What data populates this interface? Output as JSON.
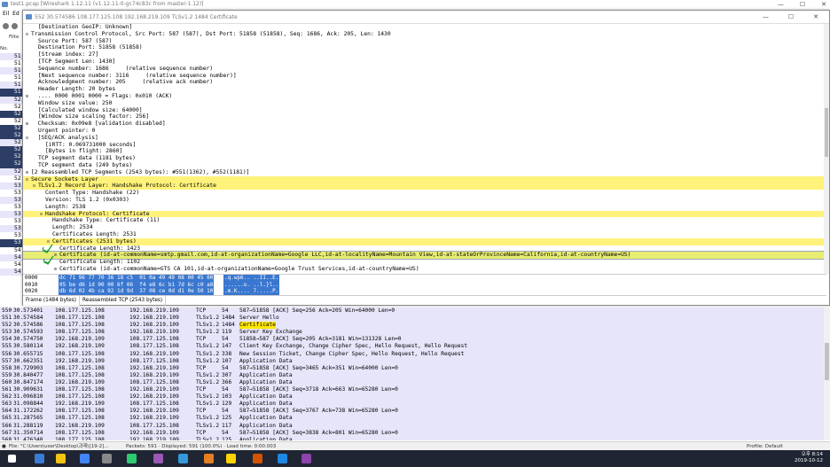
{
  "main_window": {
    "title": "test1.pcap  [Wireshark 1.12.11  (v1.12.11-0-gc74c83c from master-1.12)]",
    "menu": [
      "Eil",
      "Ed"
    ],
    "filter_label": "Filte",
    "no_header": "No.",
    "left_numbers": [
      "51",
      "51",
      "51",
      "51",
      "51",
      "51",
      "52",
      "52",
      "52",
      "52",
      "52",
      "52",
      "52",
      "52",
      "52",
      "52",
      "52",
      "52",
      "53",
      "53",
      "53",
      "53",
      "53",
      "53",
      "53",
      "53",
      "53",
      "54",
      "54",
      "54",
      "54"
    ]
  },
  "detail_window": {
    "title": "552 30.574586 108.177.125.108 192.168.219.109 TLSv1.2 1484 Certificate",
    "tree": [
      {
        "indent": 1,
        "toggle": "",
        "text": "[Destination GeoIP: Unknown]",
        "style": ""
      },
      {
        "indent": 0,
        "toggle": "⊟",
        "text": "Transmission Control Protocol, Src Port: 587 (587), Dst Port: 51858 (51858), Seq: 1686, Ack: 205, Len: 1430",
        "style": ""
      },
      {
        "indent": 1,
        "toggle": "",
        "text": "Source Port: 587 (587)",
        "style": ""
      },
      {
        "indent": 1,
        "toggle": "",
        "text": "Destination Port: 51858 (51858)",
        "style": ""
      },
      {
        "indent": 1,
        "toggle": "",
        "text": "[Stream index: 27]",
        "style": ""
      },
      {
        "indent": 1,
        "toggle": "",
        "text": "[TCP Segment Len: 1430]",
        "style": ""
      },
      {
        "indent": 1,
        "toggle": "",
        "text": "Sequence number: 1686     (relative sequence number)",
        "style": ""
      },
      {
        "indent": 1,
        "toggle": "",
        "text": "[Next sequence number: 3116     (relative sequence number)]",
        "style": ""
      },
      {
        "indent": 1,
        "toggle": "",
        "text": "Acknowledgment number: 205     (relative ack number)",
        "style": ""
      },
      {
        "indent": 1,
        "toggle": "",
        "text": "Header Length: 20 bytes",
        "style": ""
      },
      {
        "indent": 0,
        "toggle": "⊞",
        "text": "  .... 0000 0001 0000 = Flags: 0x010 (ACK)",
        "style": ""
      },
      {
        "indent": 1,
        "toggle": "",
        "text": "Window size value: 250",
        "style": ""
      },
      {
        "indent": 1,
        "toggle": "",
        "text": "[Calculated window size: 64000]",
        "style": ""
      },
      {
        "indent": 1,
        "toggle": "",
        "text": "[Window size scaling factor: 256]",
        "style": ""
      },
      {
        "indent": 0,
        "toggle": "⊞",
        "text": "  Checksum: 0x09e8 [validation disabled]",
        "style": ""
      },
      {
        "indent": 1,
        "toggle": "",
        "text": "Urgent pointer: 0",
        "style": ""
      },
      {
        "indent": 0,
        "toggle": "⊟",
        "text": "  [SEQ/ACK analysis]",
        "style": ""
      },
      {
        "indent": 2,
        "toggle": "",
        "text": "[iRTT: 0.069731000 seconds]",
        "style": ""
      },
      {
        "indent": 2,
        "toggle": "",
        "text": "[Bytes in flight: 2860]",
        "style": ""
      },
      {
        "indent": 1,
        "toggle": "",
        "text": "TCP segment data (1181 bytes)",
        "style": ""
      },
      {
        "indent": 1,
        "toggle": "",
        "text": "TCP segment data (249 bytes)",
        "style": ""
      },
      {
        "indent": 0,
        "toggle": "⊞",
        "text": "[2 Reassembled TCP Segments (2543 bytes): #551(1362), #552(1181)]",
        "style": ""
      },
      {
        "indent": 0,
        "toggle": "⊟",
        "text": "Secure Sockets Layer",
        "style": "hl"
      },
      {
        "indent": 1,
        "toggle": "⊟",
        "text": "TLSv1.2 Record Layer: Handshake Protocol: Certificate",
        "style": "hl"
      },
      {
        "indent": 2,
        "toggle": "",
        "text": "Content Type: Handshake (22)",
        "style": ""
      },
      {
        "indent": 2,
        "toggle": "",
        "text": "Version: TLS 1.2 (0x0303)",
        "style": ""
      },
      {
        "indent": 2,
        "toggle": "",
        "text": "Length: 2538",
        "style": ""
      },
      {
        "indent": 2,
        "toggle": "⊟",
        "text": "Handshake Protocol: Certificate",
        "style": "hl"
      },
      {
        "indent": 3,
        "toggle": "",
        "text": "Handshake Type: Certificate (11)",
        "style": ""
      },
      {
        "indent": 3,
        "toggle": "",
        "text": "Length: 2534",
        "style": ""
      },
      {
        "indent": 3,
        "toggle": "",
        "text": "Certificates Length: 2531",
        "style": ""
      },
      {
        "indent": 3,
        "toggle": "⊟",
        "text": "Certificates (2531 bytes)",
        "style": "hl"
      },
      {
        "indent": 4,
        "toggle": "",
        "text": "Certificate Length: 1423",
        "style": ""
      },
      {
        "indent": 4,
        "toggle": "⊞",
        "text": "Certificate (id-at-commonName=smtp.gmail.com,id-at-organizationName=Google LLC,id-at-localityName=Mountain View,id-at-stateOrProvinceName=California,id-at-countryName=US)",
        "style": "focus"
      },
      {
        "indent": 4,
        "toggle": "",
        "text": "Certificate Length: 1102",
        "style": ""
      },
      {
        "indent": 4,
        "toggle": "⊞",
        "text": "Certificate (id-at-commonName=GTS CA 101,id-at-organizationName=Google Trust Services,id-at-countryName=US)",
        "style": ""
      }
    ],
    "bytes": [
      {
        "offset": "0000",
        "hex": "dc 71 96 77 70 36 18 c5  01 0a 49 49 08 00 45 00",
        "ascii": ".q.wp6.. ..II..E."
      },
      {
        "offset": "0010",
        "hex": "05 be d6 1d 00 00 6f 06  f4 e8 6c b1 7d 6c c0 a8",
        "ascii": "......o. ..l.}l.."
      },
      {
        "offset": "0020",
        "hex": "db 6d 02 4b ca 92 1d 9d  37 08 ce 0d d1 0e 50 10",
        "ascii": ".m.K.... 7.....P."
      }
    ],
    "tabs": [
      "Frame (1484 bytes)",
      "Reassembled TCP (2543 bytes)"
    ]
  },
  "packets": [
    {
      "no": "550",
      "time": "30.573401",
      "src": "108.177.125.108",
      "dst": "192.168.219.109",
      "proto": "TCP",
      "len": "54",
      "info": "587→51858 [ACK] Seq=256 Ack=205 Win=64000 Len=0",
      "hl": ""
    },
    {
      "no": "551",
      "time": "30.574584",
      "src": "108.177.125.108",
      "dst": "192.168.219.109",
      "proto": "TLSv1.2",
      "len": "1484",
      "info": "Server Hello",
      "hl": ""
    },
    {
      "no": "552",
      "time": "30.574586",
      "src": "108.177.125.108",
      "dst": "192.168.219.109",
      "proto": "TLSv1.2",
      "len": "1484",
      "info": "",
      "hl": "Certificate"
    },
    {
      "no": "553",
      "time": "30.574593",
      "src": "108.177.125.108",
      "dst": "192.168.219.109",
      "proto": "TLSv1.2",
      "len": "119",
      "info": "Server Key Exchange",
      "hl": ""
    },
    {
      "no": "554",
      "time": "30.574750",
      "src": "192.168.219.109",
      "dst": "108.177.125.108",
      "proto": "TCP",
      "len": "54",
      "info": "51858→587 [ACK] Seq=205 Ack=3181 Win=131328 Len=0",
      "hl": ""
    },
    {
      "no": "555",
      "time": "30.580114",
      "src": "192.168.219.109",
      "dst": "108.177.125.108",
      "proto": "TLSv1.2",
      "len": "147",
      "info": "Client Key Exchange, Change Cipher Spec, Hello Request, Hello Request",
      "hl": ""
    },
    {
      "no": "556",
      "time": "30.655715",
      "src": "108.177.125.108",
      "dst": "192.168.219.109",
      "proto": "TLSv1.2",
      "len": "338",
      "info": "New Session Ticket, Change Cipher Spec, Hello Request, Hello Request",
      "hl": ""
    },
    {
      "no": "557",
      "time": "30.662351",
      "src": "192.168.219.109",
      "dst": "108.177.125.108",
      "proto": "TLSv1.2",
      "len": "107",
      "info": "Application Data",
      "hl": ""
    },
    {
      "no": "558",
      "time": "30.729903",
      "src": "108.177.125.108",
      "dst": "192.168.219.109",
      "proto": "TCP",
      "len": "54",
      "info": "587→51858 [ACK] Seq=3465 Ack=351 Win=64000 Len=0",
      "hl": ""
    },
    {
      "no": "559",
      "time": "30.840477",
      "src": "108.177.125.108",
      "dst": "192.168.219.109",
      "proto": "TLSv1.2",
      "len": "307",
      "info": "Application Data",
      "hl": ""
    },
    {
      "no": "560",
      "time": "30.847174",
      "src": "192.168.219.109",
      "dst": "108.177.125.108",
      "proto": "TLSv1.2",
      "len": "366",
      "info": "Application Data",
      "hl": ""
    },
    {
      "no": "561",
      "time": "30.909631",
      "src": "108.177.125.108",
      "dst": "192.168.219.109",
      "proto": "TCP",
      "len": "54",
      "info": "587→51858 [ACK] Seq=3718 Ack=663 Win=65280 Len=0",
      "hl": ""
    },
    {
      "no": "562",
      "time": "31.096810",
      "src": "108.177.125.108",
      "dst": "192.168.219.109",
      "proto": "TLSv1.2",
      "len": "103",
      "info": "Application Data",
      "hl": ""
    },
    {
      "no": "563",
      "time": "31.098844",
      "src": "192.168.219.109",
      "dst": "108.177.125.108",
      "proto": "TLSv1.2",
      "len": "129",
      "info": "Application Data",
      "hl": ""
    },
    {
      "no": "564",
      "time": "31.172262",
      "src": "108.177.125.108",
      "dst": "192.168.219.109",
      "proto": "TCP",
      "len": "54",
      "info": "587→51858 [ACK] Seq=3767 Ack=738 Win=65280 Len=0",
      "hl": ""
    },
    {
      "no": "565",
      "time": "31.287565",
      "src": "108.177.125.108",
      "dst": "192.168.219.109",
      "proto": "TLSv1.2",
      "len": "125",
      "info": "Application Data",
      "hl": ""
    },
    {
      "no": "566",
      "time": "31.288119",
      "src": "192.168.219.109",
      "dst": "108.177.125.108",
      "proto": "TLSv1.2",
      "len": "117",
      "info": "Application Data",
      "hl": ""
    },
    {
      "no": "567",
      "time": "31.350714",
      "src": "108.177.125.108",
      "dst": "192.168.219.109",
      "proto": "TCP",
      "len": "54",
      "info": "587→51858 [ACK] Seq=3838 Ack=801 Win=65280 Len=0",
      "hl": ""
    },
    {
      "no": "568",
      "time": "31.476348",
      "src": "108.177.125.108",
      "dst": "192.168.219.109",
      "proto": "TLSv1.2",
      "len": "125",
      "info": "Application Data",
      "hl": ""
    }
  ],
  "statusbar": {
    "file": "File: \"C:\\Users\\user\\Desktop\\과제\\[19-2]...",
    "packets": "Packets: 591 · Displayed: 591 (100.0%) · Load time: 0:00.003",
    "profile": "Profile: Default"
  },
  "taskbar": {
    "time": "오후 8:14",
    "date": "2019-10-12",
    "icon_colors": [
      "#ffffff",
      "#3a7bd5",
      "#f1c40f",
      "#4285f4",
      "#888888",
      "#2ecc71",
      "#9b59b6",
      "#3498db",
      "#e67e22",
      "#ffd400",
      "#d35400",
      "#1e88e5",
      "#8e44ad"
    ]
  }
}
